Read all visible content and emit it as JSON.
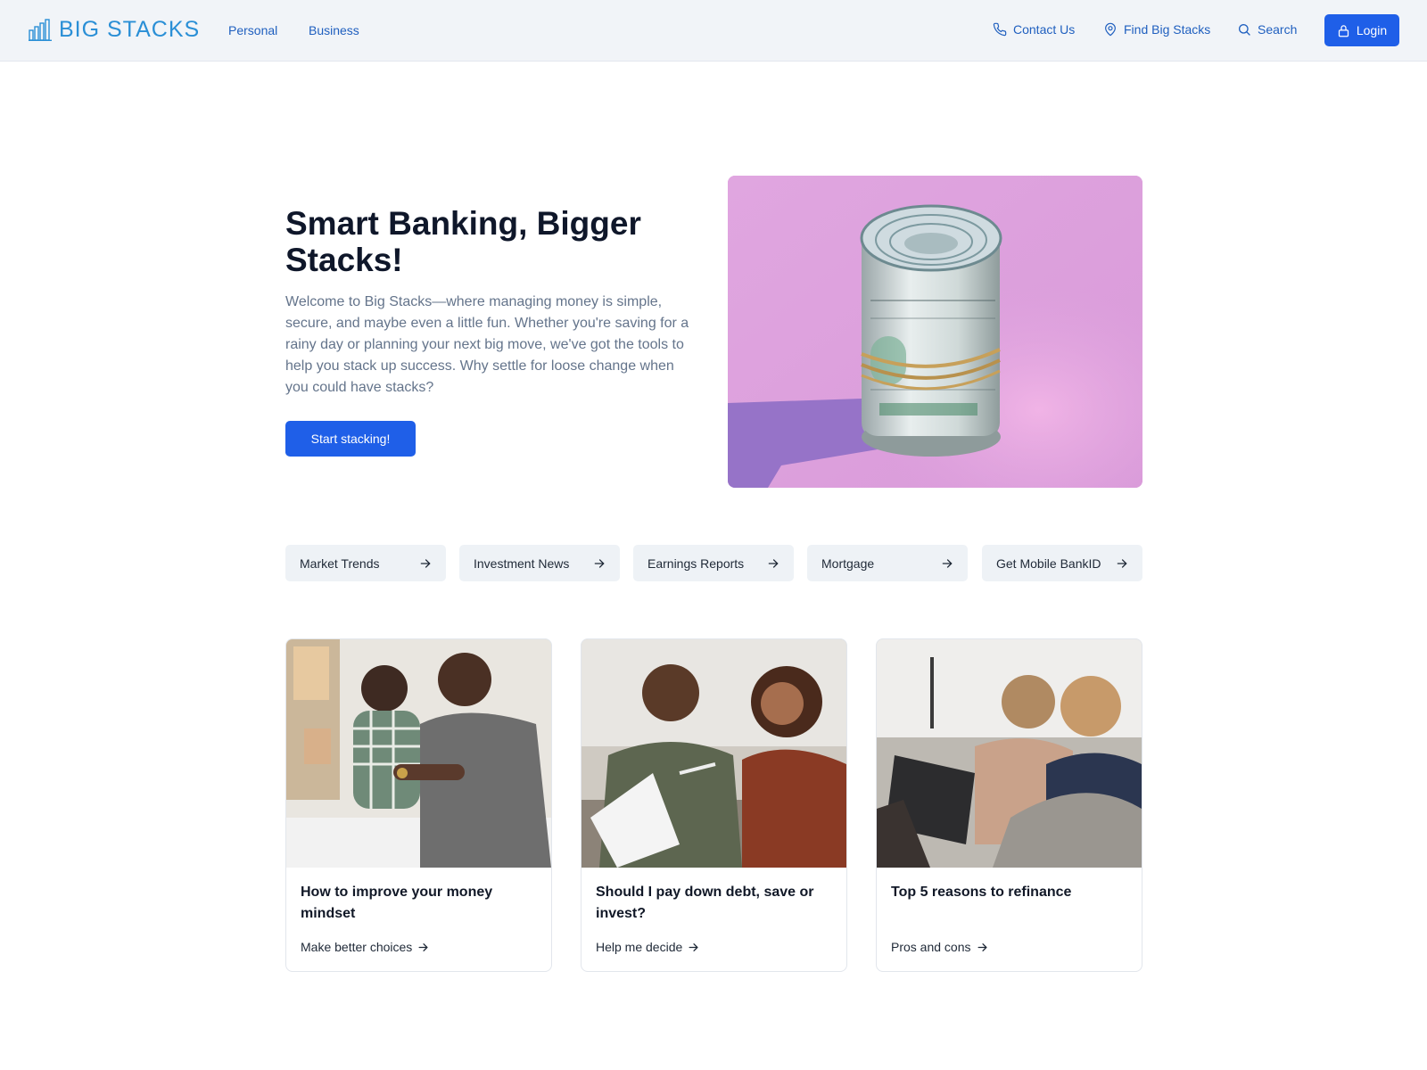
{
  "header": {
    "logo_text": "BIG STACKS",
    "nav": [
      "Personal",
      "Business"
    ],
    "utility": {
      "contact": "Contact Us",
      "find": "Find Big Stacks",
      "search": "Search"
    },
    "login": "Login",
    "accent": "#1f5fe8",
    "logo_color": "#2a8fd6"
  },
  "hero": {
    "title": "Smart Banking, Bigger Stacks!",
    "text": "Welcome to Big Stacks—where managing money is simple, secure, and maybe even a little fun. Whether you're saving for a rainy day or planning your next big move, we've got the tools to help you stack up success. Why settle for loose change when you could have stacks?",
    "cta": "Start stacking!"
  },
  "quick_links": [
    "Market Trends",
    "Investment News",
    "Earnings Reports",
    "Mortgage",
    "Get Mobile BankID"
  ],
  "cards": [
    {
      "title": "How to improve your money mindset",
      "link": "Make better choices"
    },
    {
      "title": "Should I pay down debt, save or invest?",
      "link": "Help me decide"
    },
    {
      "title": "Top 5 reasons to refinance",
      "link": "Pros and cons"
    }
  ]
}
